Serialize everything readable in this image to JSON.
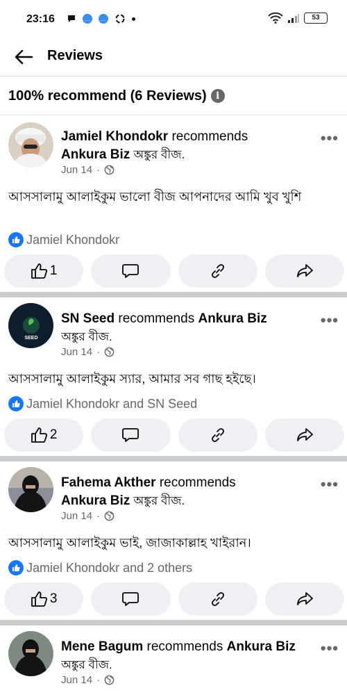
{
  "status_bar": {
    "time": "23:16",
    "battery": "53"
  },
  "header": {
    "title": "Reviews"
  },
  "summary": {
    "text": "100% recommend (6 Reviews)"
  },
  "reviews": [
    {
      "name": "Jamiel Khondokr",
      "recommends": "recommends",
      "page": "Ankura Biz",
      "page_bn": "অঙ্কুর বীজ.",
      "date": "Jun 14",
      "text": "আসসালামু আলাইকুম ভালো বীজ আপনাদের আমি খুব খুশি",
      "liked_by": "Jamiel Khondokr",
      "like_count": "1"
    },
    {
      "name": "SN Seed",
      "recommends": "recommends",
      "page": "Ankura Biz",
      "page_bn": "অঙ্কুর বীজ.",
      "date": "Jun 14",
      "text": "আসসালামু আলাইকুম স্যার, আমার সব গাছ হইছে।",
      "liked_by": "Jamiel Khondokr and SN Seed",
      "like_count": "2"
    },
    {
      "name": "Fahema Akther",
      "recommends": "recommends",
      "page": "Ankura Biz",
      "page_bn": "অঙ্কুর বীজ.",
      "date": "Jun 14",
      "text": "আসসালামু আলাইকুম ভাই, জাজাকাল্লাহ খাইরান।",
      "liked_by": "Jamiel Khondokr and 2 others",
      "like_count": "3"
    },
    {
      "name": "Mene Bagum",
      "recommends": "recommends",
      "page": "Ankura Biz",
      "page_bn": "অঙ্কুর বীজ.",
      "date": "Jun 14"
    }
  ],
  "avatar_labels": {
    "sn_seed": "SEED"
  },
  "colors": {
    "accent": "#1877f2",
    "muted": "#65676b",
    "pill": "#eef0f3",
    "separator": "#c9ccd1"
  }
}
